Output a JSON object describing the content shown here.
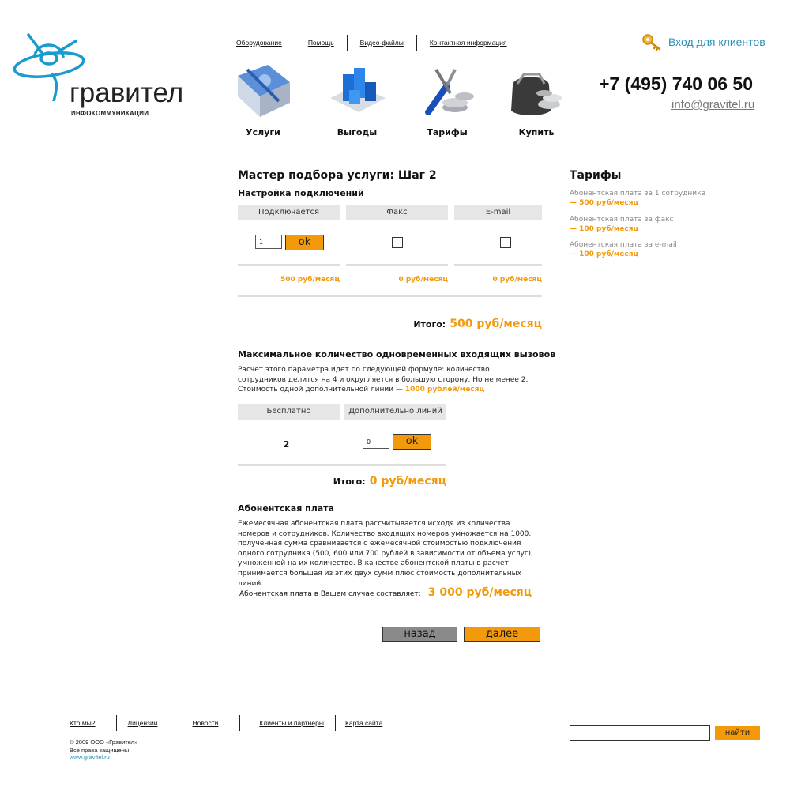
{
  "logo": {
    "name": "гравител",
    "tagline": "ИНФОКОММУНИКАЦИИ"
  },
  "top_nav": [
    "Оборудование",
    "Помощь",
    "Видео-файлы",
    "Контактная информация"
  ],
  "login_label": "Вход для клиентов",
  "phone": "+7 (495) 740 06 50",
  "email": "info@gravitel.ru",
  "menu": [
    {
      "label": "Услуги",
      "icon": "book-icon"
    },
    {
      "label": "Выгоды",
      "icon": "bar-blocks-icon"
    },
    {
      "label": "Тарифы",
      "icon": "tools-coins-icon"
    },
    {
      "label": "Купить",
      "icon": "wallet-icon"
    }
  ],
  "wizard": {
    "title": "Мастер подбора услуги: Шаг 2",
    "connections": {
      "heading": "Настройка подключений",
      "columns": [
        "Подключается",
        "Факс",
        "E-mail"
      ],
      "count_value": "1",
      "ok_label": "ok",
      "prices": [
        "500 руб/месяц",
        "0 руб/месяц",
        "0 руб/месяц"
      ],
      "total_label": "Итого:",
      "total_value": "500 руб/месяц"
    },
    "calls": {
      "heading": "Максимальное количество одновременных входящих вызовов",
      "text": "Расчет этого параметра идет по следующей формуле: количество сотрудников делится на 4 и округляется в большую сторону. Но не менее 2. Стоимость одной дополнительной линии —",
      "line_price": "1000 рублей/месяц",
      "columns": [
        "Бесплатно",
        "Дополнительно линий"
      ],
      "free_value": "2",
      "extra_value": "0",
      "ok_label": "ok",
      "total_label": "Итого:",
      "total_value": "0 руб/месяц"
    },
    "fee": {
      "heading": "Абонентская плата",
      "text": "Ежемесячная абонентская плата рассчитывается исходя из  количества номеров и сотрудников.  Количество входящих номеров умножается на 1000, полученная сумма сравнивается с ежемесячной  стоимостью подключения одного сотрудника (500, 600 или 700 рублей в зависимости от объема услуг), умноженной на их количество.  В качестве абонентской платы в расчет принимается большая из этих двух сумм плюс стоимость дополнительных линий.",
      "result_label": "Абонентская плата в Вашем случае  составляет:",
      "result_value": "3 000 руб/месяц"
    },
    "back_label": "назад",
    "next_label": "далее"
  },
  "tariffs": {
    "heading": "Тарифы",
    "items": [
      {
        "label": "Абонентская плата за 1 сотрудника",
        "price": "— 500 руб/месяц"
      },
      {
        "label": "Абонентская плата за факс",
        "price": "— 100 руб/месяц"
      },
      {
        "label": "Абонентская плата за e-mail",
        "price": "— 100 руб/месяц"
      }
    ]
  },
  "footer": {
    "nav": [
      "Кто мы?",
      "Лицензии",
      "Новости",
      "Клиенты и партнеры",
      "Карта сайта"
    ],
    "copyright": "© 2009 ООО «Гравител»",
    "rights": "Все права защищены.",
    "site": "www.gravitel.ru",
    "search_button": "найти"
  },
  "colors": {
    "accent": "#f39a0c",
    "link": "#2a8fb6",
    "logo": "#1a9bd0"
  }
}
